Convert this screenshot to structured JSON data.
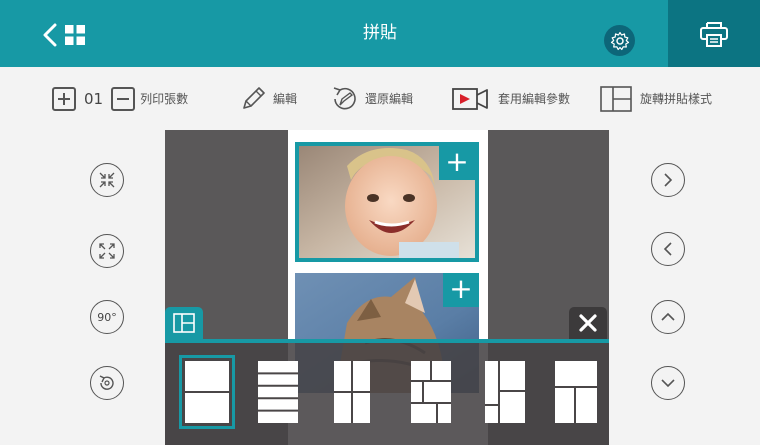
{
  "header": {
    "title": "拼貼",
    "back_icon": "chevron-left-icon",
    "grid_icon": "grid-icon",
    "settings_icon": "gear-icon",
    "print_icon": "printer-icon"
  },
  "toolbar": {
    "count": "01",
    "print_count_label": "列印張數",
    "edit_label": "編輯",
    "restore_label": "還原編輯",
    "apply_params_label": "套用編輯參數",
    "rotate_layout_label": "旋轉拼貼樣式"
  },
  "left_controls": [
    {
      "icon": "shrink-icon"
    },
    {
      "icon": "expand-icon"
    },
    {
      "icon": "rotate-90-icon",
      "label": "90°"
    },
    {
      "icon": "reset-icon"
    }
  ],
  "right_controls": [
    {
      "icon": "chevron-right-icon"
    },
    {
      "icon": "chevron-left-icon"
    },
    {
      "icon": "chevron-up-icon"
    },
    {
      "icon": "chevron-down-icon"
    }
  ],
  "canvas": {
    "slots": [
      {
        "content": "photo-baby",
        "add_icon": "+"
      },
      {
        "content": "photo-kitten",
        "add_icon": "+"
      }
    ]
  },
  "layout_tray": {
    "tab_icon": "layout-icon",
    "close_icon": "close-icon",
    "selected_index": 0,
    "layouts": [
      "two-rows",
      "five-rows",
      "four-grid",
      "five-grid-mixed",
      "four-grid-mixed",
      "three-mixed"
    ]
  },
  "colors": {
    "accent": "#1799a5",
    "accent_dark": "#0c7482",
    "canvas_bg": "#5a5859"
  }
}
